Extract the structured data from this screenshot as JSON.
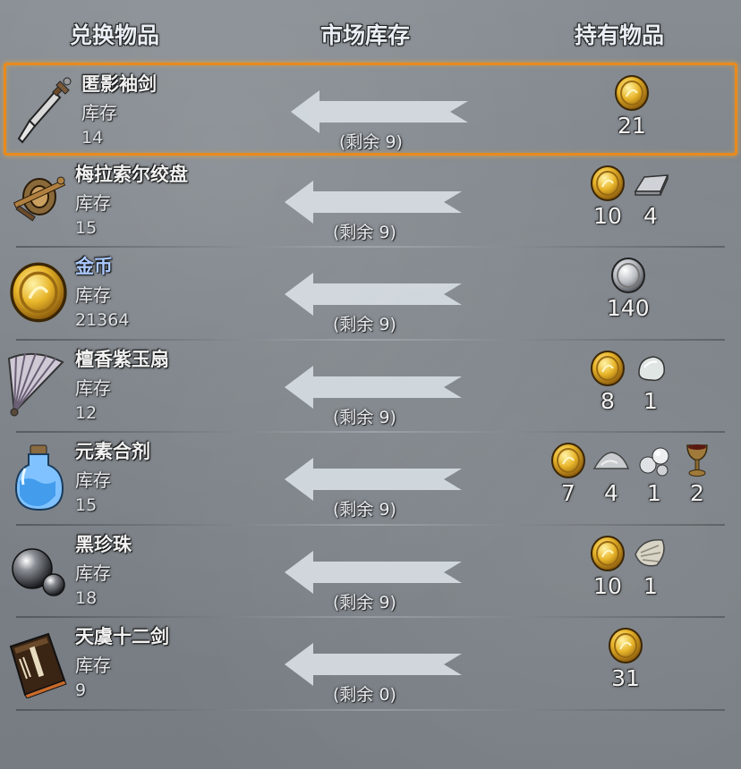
{
  "header": {
    "exchange": "兑换物品",
    "market": "市场库存",
    "held": "持有物品"
  },
  "stock_label": "库存",
  "items": [
    {
      "name": "匿影袖剑",
      "stock": "14",
      "remain": "(剩余 9)",
      "icon": "dagger-icon",
      "selected": true,
      "held": [
        {
          "icon": "gold-coin-icon",
          "count": "21"
        }
      ]
    },
    {
      "name": "梅拉索尔绞盘",
      "stock": "15",
      "remain": "(剩余 9)",
      "icon": "winch-icon",
      "held": [
        {
          "icon": "gold-coin-icon",
          "count": "10"
        },
        {
          "icon": "iron-ingot-icon",
          "count": "4"
        }
      ]
    },
    {
      "name": "金币",
      "stock": "21364",
      "remain": "(剩余 9)",
      "icon": "gold-coin-icon",
      "name_color": "#aac9ff",
      "held": [
        {
          "icon": "silver-coin-icon",
          "count": "140"
        }
      ]
    },
    {
      "name": "檀香紫玉扇",
      "stock": "12",
      "remain": "(剩余 9)",
      "icon": "folding-fan-icon",
      "held": [
        {
          "icon": "gold-coin-icon",
          "count": "8"
        },
        {
          "icon": "white-jade-icon",
          "count": "1"
        }
      ]
    },
    {
      "name": "元素合剂",
      "stock": "15",
      "remain": "(剩余 9)",
      "icon": "potion-bottle-icon",
      "held": [
        {
          "icon": "gold-coin-icon",
          "count": "7"
        },
        {
          "icon": "powder-pile-icon",
          "count": "4"
        },
        {
          "icon": "pearls-icon",
          "count": "1"
        },
        {
          "icon": "goblet-icon",
          "count": "2"
        }
      ]
    },
    {
      "name": "黑珍珠",
      "stock": "18",
      "remain": "(剩余 9)",
      "icon": "black-pearl-icon",
      "held": [
        {
          "icon": "gold-coin-icon",
          "count": "10"
        },
        {
          "icon": "oyster-shell-icon",
          "count": "1"
        }
      ]
    },
    {
      "name": "天虞十二剑",
      "stock": "9",
      "remain": "(剩余 0)",
      "icon": "manual-book-icon",
      "held": [
        {
          "icon": "gold-coin-icon",
          "count": "31"
        }
      ]
    }
  ],
  "colors": {
    "selected_border": "#e98a1c",
    "arrow": "#d7dde3",
    "highlight_name": "#aac9ff"
  }
}
